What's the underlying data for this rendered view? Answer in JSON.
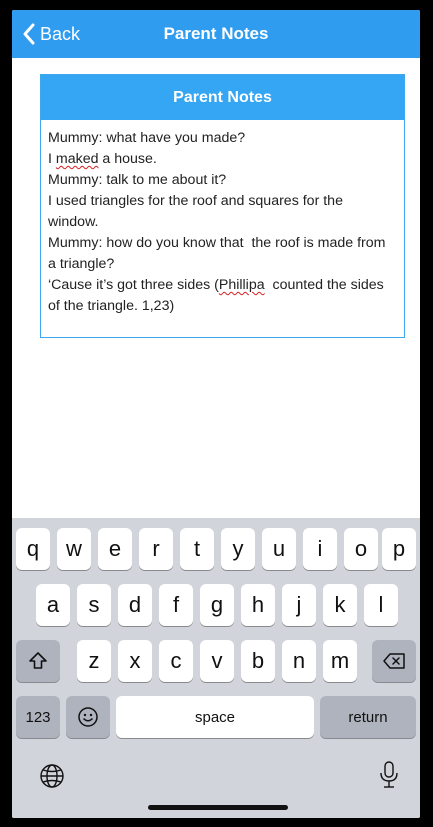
{
  "navbar": {
    "back_label": "Back",
    "title": "Parent Notes",
    "background": "#2f9cf0"
  },
  "notes": {
    "header": "Parent Notes",
    "lines": [
      "Mummy: what have you made?",
      "I ",
      "maked",
      " a house.",
      "Mummy: talk to me about it?",
      "I used triangles for the roof and squares for the window.",
      "Mummy: how do you know that  the roof is made from a triangle?",
      "‘Cause it’s got three sides (",
      "Phillipa",
      "  counted the sides of the triangle. 1,23)"
    ]
  },
  "keyboard": {
    "row1": [
      "q",
      "w",
      "e",
      "r",
      "t",
      "y",
      "u",
      "i",
      "o",
      "p"
    ],
    "row2": [
      "a",
      "s",
      "d",
      "f",
      "g",
      "h",
      "j",
      "k",
      "l"
    ],
    "row3": [
      "z",
      "x",
      "c",
      "v",
      "b",
      "n",
      "m"
    ],
    "numbers_label": "123",
    "space_label": "space",
    "return_label": "return",
    "shift_icon": "shift-icon",
    "delete_icon": "delete-icon",
    "emoji_icon": "emoji-icon",
    "globe_icon": "globe-icon",
    "mic_icon": "microphone-icon"
  }
}
